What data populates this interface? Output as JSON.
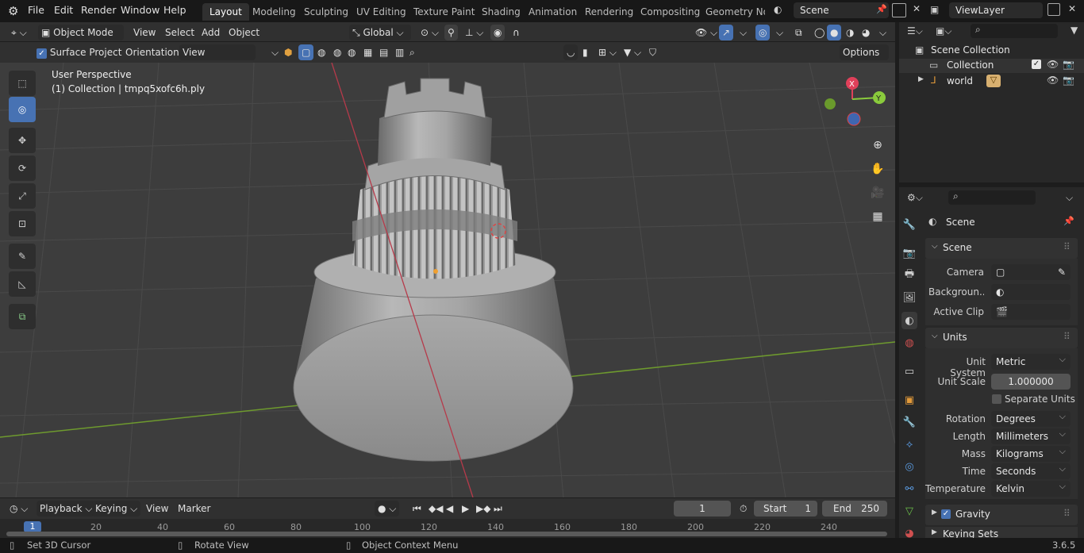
{
  "topbar": {
    "menus": [
      "File",
      "Edit",
      "Render",
      "Window",
      "Help"
    ],
    "workspaces": [
      "Layout",
      "Modeling",
      "Sculpting",
      "UV Editing",
      "Texture Paint",
      "Shading",
      "Animation",
      "Rendering",
      "Compositing",
      "Geometry Noc"
    ],
    "active_workspace": "Layout",
    "scene_name": "Scene",
    "view_layer": "ViewLayer"
  },
  "viewport_header": {
    "mode": "Object Mode",
    "menus": [
      "View",
      "Select",
      "Add",
      "Object"
    ],
    "transform_orientation": "Global",
    "surface_project": "Surface Project",
    "orientation_label": "Orientation:",
    "orientation_value": "View",
    "options": "Options"
  },
  "viewport": {
    "perspective_label": "User Perspective",
    "collection_label": "(1) Collection | tmpq5xofc6h.ply",
    "axis_colors": {
      "x": "#e0405a",
      "y": "#8acb3c",
      "z": "#4b86e0"
    },
    "gizmo_labels": [
      "X",
      "Y"
    ]
  },
  "outliner": {
    "root": "Scene Collection",
    "items": [
      {
        "label": "Collection"
      },
      {
        "label": "world"
      }
    ]
  },
  "properties": {
    "context": "Scene",
    "scene_panel": {
      "title": "Scene",
      "camera_label": "Camera",
      "background_label": "Backgroun...",
      "active_clip_label": "Active Clip"
    },
    "units_panel": {
      "title": "Units",
      "rows": [
        {
          "label": "Unit System",
          "value": "Metric"
        },
        {
          "label": "Unit Scale",
          "value": "1.000000"
        },
        {
          "label": "Rotation",
          "value": "Degrees"
        },
        {
          "label": "Length",
          "value": "Millimeters"
        },
        {
          "label": "Mass",
          "value": "Kilograms"
        },
        {
          "label": "Time",
          "value": "Seconds"
        },
        {
          "label": "Temperature",
          "value": "Kelvin"
        }
      ],
      "separate_units": "Separate Units"
    },
    "gravity_panel": {
      "title": "Gravity"
    },
    "keying_sets_panel": {
      "title": "Keying Sets"
    }
  },
  "timeline": {
    "menus": [
      "Playback",
      "Keying",
      "View",
      "Marker"
    ],
    "current_frame": "1",
    "start_label": "Start",
    "start_value": "1",
    "end_label": "End",
    "end_value": "250",
    "ruler": [
      "1",
      "20",
      "40",
      "60",
      "80",
      "100",
      "120",
      "140",
      "160",
      "180",
      "200",
      "220",
      "240"
    ]
  },
  "status": {
    "items": [
      "Set 3D Cursor",
      "Rotate View",
      "Object Context Menu"
    ],
    "version": "3.6.5"
  }
}
